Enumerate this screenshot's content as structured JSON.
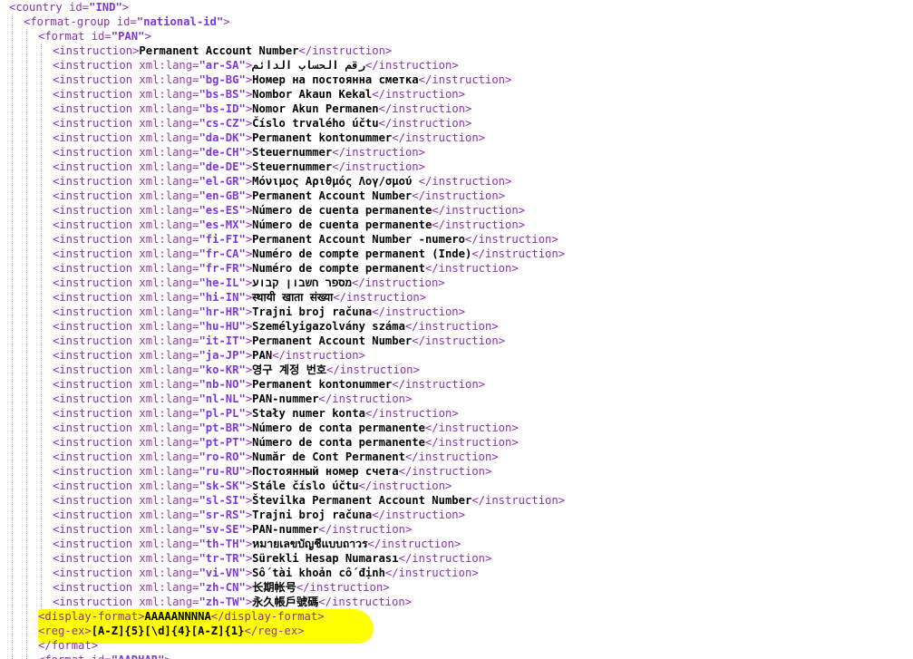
{
  "xml": {
    "country_id": "IND",
    "format_group_id": "national-id",
    "format_id": "PAN",
    "default_instruction": "Permanent Account Number",
    "instructions": [
      {
        "lang": "ar-SA",
        "text": "رقم الحساب الدائم"
      },
      {
        "lang": "bg-BG",
        "text": "Номер на постоянна сметка"
      },
      {
        "lang": "bs-BS",
        "text": "Nombor Akaun Kekal"
      },
      {
        "lang": "bs-ID",
        "text": "Nomor Akun Permanen"
      },
      {
        "lang": "cs-CZ",
        "text": "Číslo trvalého účtu"
      },
      {
        "lang": "da-DK",
        "text": "Permanent kontonummer"
      },
      {
        "lang": "de-CH",
        "text": "Steuernummer"
      },
      {
        "lang": "de-DE",
        "text": "Steuernummer"
      },
      {
        "lang": "el-GR",
        "text": "Μόνιμος Αριθμός Λογ/σμού "
      },
      {
        "lang": "en-GB",
        "text": "Permanent Account Number"
      },
      {
        "lang": "es-ES",
        "text": "Número de cuenta permanente"
      },
      {
        "lang": "es-MX",
        "text": "Número de cuenta permanente"
      },
      {
        "lang": "fi-FI",
        "text": "Permanent Account Number -numero"
      },
      {
        "lang": "fr-CA",
        "text": "Numéro de compte permanent (Inde)"
      },
      {
        "lang": "fr-FR",
        "text": "Numéro de compte permanent"
      },
      {
        "lang": "he-IL",
        "text": "מספר חשבון קבוע"
      },
      {
        "lang": "hi-IN",
        "text": "स्थायी खाता संख्या"
      },
      {
        "lang": "hr-HR",
        "text": "Trajni broj računa"
      },
      {
        "lang": "hu-HU",
        "text": "Személyigazolvány száma"
      },
      {
        "lang": "it-IT",
        "text": "Permanent Account Number"
      },
      {
        "lang": "ja-JP",
        "text": "PAN"
      },
      {
        "lang": "ko-KR",
        "text": "영구 계정 번호"
      },
      {
        "lang": "nb-NO",
        "text": "Permanent kontonummer"
      },
      {
        "lang": "nl-NL",
        "text": "PAN-nummer"
      },
      {
        "lang": "pl-PL",
        "text": "Stały numer konta"
      },
      {
        "lang": "pt-BR",
        "text": "Número de conta permanente"
      },
      {
        "lang": "pt-PT",
        "text": "Número de conta permanente"
      },
      {
        "lang": "ro-RO",
        "text": "Număr de Cont Permanent"
      },
      {
        "lang": "ru-RU",
        "text": "Постоянный номер счета"
      },
      {
        "lang": "sk-SK",
        "text": "Stále číslo účtu"
      },
      {
        "lang": "sl-SI",
        "text": "Številka Permanent Account Number"
      },
      {
        "lang": "sr-RS",
        "text": "Trajni broj računa"
      },
      {
        "lang": "sv-SE",
        "text": "PAN-nummer"
      },
      {
        "lang": "th-TH",
        "text": "หมายเลขบัญชีแบบถาวร"
      },
      {
        "lang": "tr-TR",
        "text": "Sürekli Hesap Numarası"
      },
      {
        "lang": "vi-VN",
        "text": "Số tài khoản cố định"
      },
      {
        "lang": "zh-CN",
        "text": "长期帐号"
      },
      {
        "lang": "zh-TW",
        "text": "永久帳戶號碼"
      }
    ],
    "display_format": "AAAAANNNNA",
    "regex": "[A-Z]{5}[\\d]{4}[A-Z]{1}",
    "next_format_id_partial": "AADHAR"
  },
  "tags": {
    "country": "country",
    "format_group": "format-group",
    "format": "format",
    "instruction": "instruction",
    "display_format": "display-format",
    "regex": "reg-ex",
    "attr_id": "id",
    "attr_xml_lang": "xml:lang"
  },
  "colors": {
    "tag": "#8b2fb3",
    "attribute": "#9a3aa0",
    "attribute_value": "#7a36e0",
    "text": "#000000",
    "highlight": "#ffff00",
    "background": "#ffffff"
  }
}
